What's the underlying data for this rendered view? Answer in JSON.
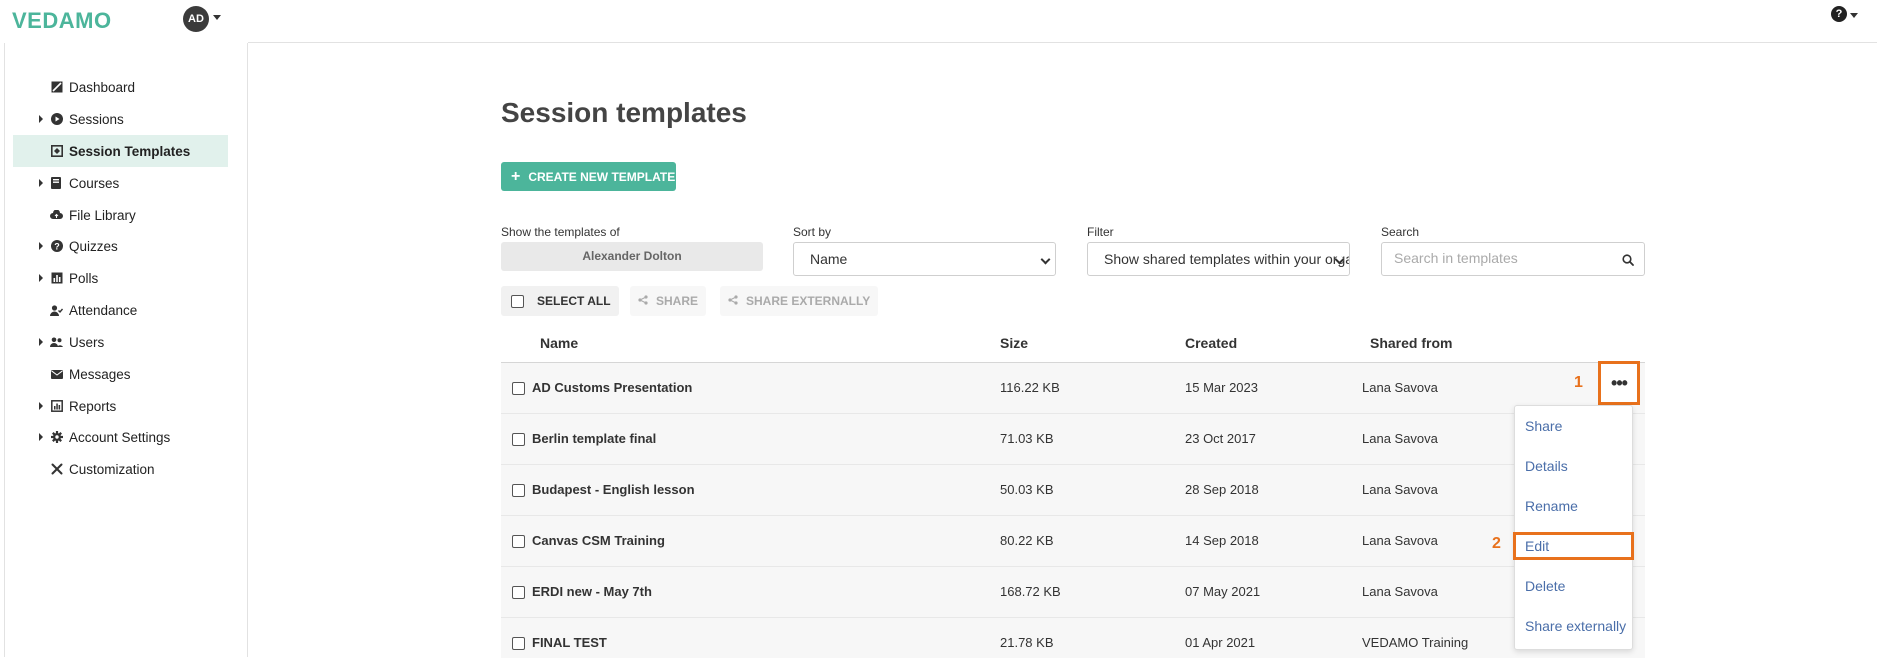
{
  "app": {
    "logo": "VEDAMO",
    "user_initials": "AD",
    "help_glyph": "?"
  },
  "sidebar": {
    "items": [
      {
        "label": "Dashboard",
        "icon": "dashboard-icon",
        "expandable": false,
        "active": false
      },
      {
        "label": "Sessions",
        "icon": "play-circle-icon",
        "expandable": true,
        "active": false
      },
      {
        "label": "Session Templates",
        "icon": "template-icon",
        "expandable": false,
        "active": true
      },
      {
        "label": "Courses",
        "icon": "book-icon",
        "expandable": true,
        "active": false
      },
      {
        "label": "File Library",
        "icon": "cloud-icon",
        "expandable": false,
        "active": false
      },
      {
        "label": "Quizzes",
        "icon": "question-circle-icon",
        "expandable": true,
        "active": false
      },
      {
        "label": "Polls",
        "icon": "bar-chart-icon",
        "expandable": true,
        "active": false
      },
      {
        "label": "Attendance",
        "icon": "user-check-icon",
        "expandable": false,
        "active": false
      },
      {
        "label": "Users",
        "icon": "users-icon",
        "expandable": true,
        "active": false
      },
      {
        "label": "Messages",
        "icon": "envelope-icon",
        "expandable": false,
        "active": false
      },
      {
        "label": "Reports",
        "icon": "report-icon",
        "expandable": true,
        "active": false
      },
      {
        "label": "Account Settings",
        "icon": "gear-icon",
        "expandable": true,
        "active": false
      },
      {
        "label": "Customization",
        "icon": "tools-icon",
        "expandable": false,
        "active": false
      }
    ]
  },
  "main": {
    "title": "Session templates",
    "create_button": {
      "plus": "+",
      "label": "CREATE NEW TEMPLATE"
    },
    "filters": {
      "owner_label": "Show the templates of",
      "owner_value": "Alexander Dolton",
      "sort_label": "Sort by",
      "sort_value": "Name",
      "filter_label": "Filter",
      "filter_value": "Show shared templates within your organization",
      "search_label": "Search",
      "search_placeholder": "Search in templates"
    },
    "toolbar": {
      "select_all": "SELECT ALL",
      "share": "SHARE",
      "share_externally": "SHARE EXTERNALLY"
    },
    "table": {
      "columns": [
        "Name",
        "Size",
        "Created",
        "Shared from"
      ],
      "rows": [
        {
          "name": "AD Customs Presentation",
          "size": "116.22 KB",
          "created": "15 Mar 2023",
          "shared_from": "Lana Savova"
        },
        {
          "name": "Berlin template final",
          "size": "71.03 KB",
          "created": "23 Oct 2017",
          "shared_from": "Lana Savova"
        },
        {
          "name": "Budapest - English lesson",
          "size": "50.03 KB",
          "created": "28 Sep 2018",
          "shared_from": "Lana Savova"
        },
        {
          "name": "Canvas CSM Training",
          "size": "80.22 KB",
          "created": "14 Sep 2018",
          "shared_from": "Lana Savova"
        },
        {
          "name": "ERDI new - May 7th",
          "size": "168.72 KB",
          "created": "07 May 2021",
          "shared_from": "Lana Savova"
        },
        {
          "name": "FINAL TEST",
          "size": "21.78 KB",
          "created": "01 Apr 2021",
          "shared_from": "VEDAMO Training"
        }
      ]
    },
    "row_actions": {
      "more_glyph": "•••",
      "menu": [
        "Share",
        "Details",
        "Rename",
        "Edit",
        "Delete",
        "Share externally"
      ]
    },
    "annotations": {
      "step1": "1",
      "step2": "2",
      "highlight_color": "#e8711c"
    }
  },
  "colors": {
    "brand": "#4cb59b",
    "active_bg": "#e1f1ec",
    "link": "#4a6ea9"
  }
}
